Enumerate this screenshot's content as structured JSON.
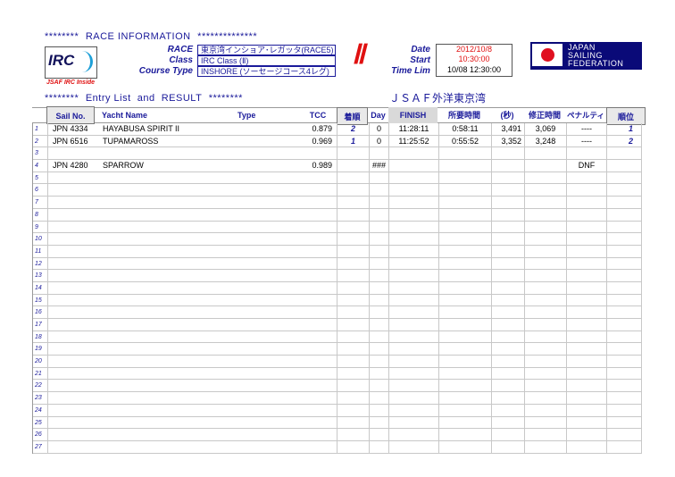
{
  "race_info": {
    "heading_prefix": "********",
    "heading": "RACE INFORMATION",
    "heading_suffix": "**************",
    "race_label": "RACE",
    "race_value": "東京湾インショア･レガッタ(RACE5)",
    "class_label": "Class",
    "class_value": "IRC Class (Ⅱ)",
    "course_label": "Course Type",
    "course_value": "INSHORE (ソーセージコース4レグ)",
    "roman": "Ⅱ",
    "date_label": "Date",
    "date_value": "2012/10/8",
    "start_label": "Start",
    "start_value": "10:30:00",
    "limit_label": "Time Limit",
    "limit_value": "10/08 12:30:00"
  },
  "logos": {
    "irc_text": "IRC",
    "irc_inside": "JSAF IRC Inside",
    "federation_line1": "JAPAN",
    "federation_line2": "SAILING",
    "federation_line3": "FEDERATION",
    "accent_color": "#1a1a9a",
    "red": "#e01010"
  },
  "entry_heading": {
    "prefix": "********",
    "text": "Entry List  and  RESULT",
    "suffix": "********",
    "venue": "ＪＳＡＦ外洋東京湾"
  },
  "columns": {
    "sail_no": "Sail No.",
    "yacht_name": "Yacht Name",
    "type": "Type",
    "tcc": "TCC",
    "arrival": "着順",
    "day": "Day",
    "finish": "FINISH",
    "elapsed": "所要時間",
    "seconds": "(秒)",
    "corrected": "修正時間",
    "penalty": "ペナルティ",
    "rank": "順位"
  },
  "rows": [
    {
      "n": "1",
      "sail": "JPN 4334",
      "name": "HAYABUSA SPIRIT II",
      "type": "",
      "tcc": "0.879",
      "arr": "2",
      "day": "0",
      "finish": "11:28:11",
      "elapsed": "0:58:11",
      "sec": "3,491",
      "corr": "3,069",
      "pen": "----",
      "rank": "1"
    },
    {
      "n": "2",
      "sail": "JPN 6516",
      "name": "TUPAMAROSS",
      "type": "",
      "tcc": "0.969",
      "arr": "1",
      "day": "0",
      "finish": "11:25:52",
      "elapsed": "0:55:52",
      "sec": "3,352",
      "corr": "3,248",
      "pen": "----",
      "rank": "2"
    },
    {
      "n": "3",
      "sail": "",
      "name": "",
      "type": "",
      "tcc": "",
      "arr": "",
      "day": "",
      "finish": "",
      "elapsed": "",
      "sec": "",
      "corr": "",
      "pen": "",
      "rank": ""
    },
    {
      "n": "4",
      "sail": "JPN 4280",
      "name": "SPARROW",
      "type": "",
      "tcc": "0.989",
      "arr": "",
      "day": "###",
      "finish": "",
      "elapsed": "",
      "sec": "",
      "corr": "",
      "pen": "DNF",
      "rank": ""
    },
    {
      "n": "5"
    },
    {
      "n": "6"
    },
    {
      "n": "7"
    },
    {
      "n": "8"
    },
    {
      "n": "9"
    },
    {
      "n": "10"
    },
    {
      "n": "11"
    },
    {
      "n": "12"
    },
    {
      "n": "13"
    },
    {
      "n": "14"
    },
    {
      "n": "15"
    },
    {
      "n": "16"
    },
    {
      "n": "17"
    },
    {
      "n": "18"
    },
    {
      "n": "19"
    },
    {
      "n": "20"
    },
    {
      "n": "21"
    },
    {
      "n": "22"
    },
    {
      "n": "23"
    },
    {
      "n": "24"
    },
    {
      "n": "25"
    },
    {
      "n": "26"
    },
    {
      "n": "27"
    }
  ]
}
